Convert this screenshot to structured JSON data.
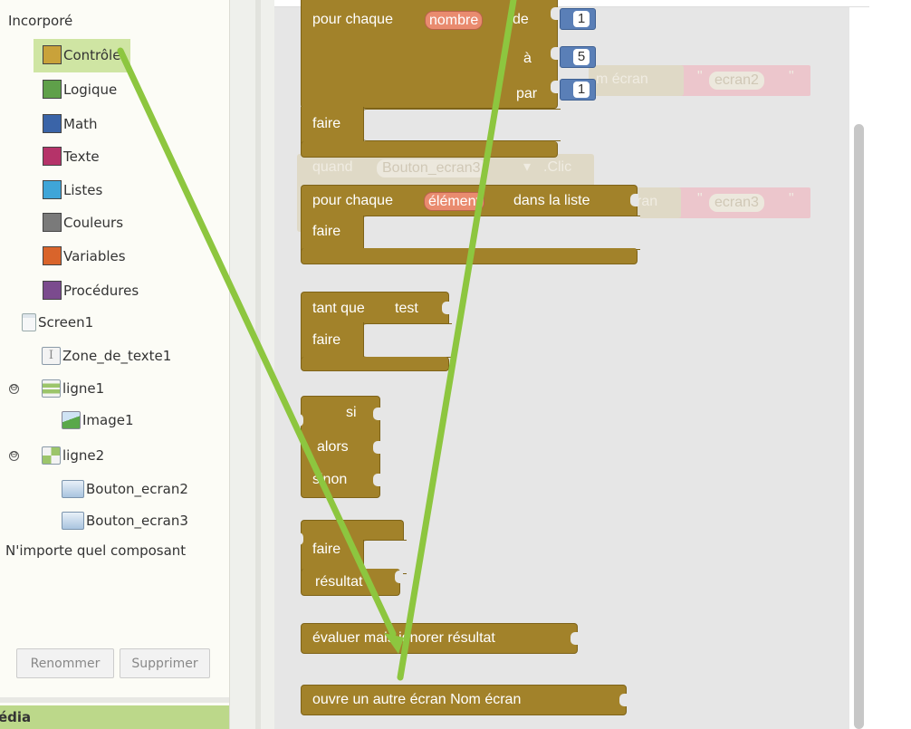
{
  "tree": {
    "header": "Incorporé",
    "builtins": [
      {
        "label": "Contrôle",
        "color": "#c9a23a",
        "icon": "control-swatch-icon",
        "selected": true
      },
      {
        "label": "Logique",
        "color": "#5fa04a",
        "icon": "logic-swatch-icon"
      },
      {
        "label": "Math",
        "color": "#3a64a8",
        "icon": "math-swatch-icon"
      },
      {
        "label": "Texte",
        "color": "#b53369",
        "icon": "text-swatch-icon"
      },
      {
        "label": "Listes",
        "color": "#3fa5d8",
        "icon": "lists-swatch-icon"
      },
      {
        "label": "Couleurs",
        "color": "#7a7a7a",
        "icon": "colors-swatch-icon"
      },
      {
        "label": "Variables",
        "color": "#d9642b",
        "icon": "variables-swatch-icon"
      },
      {
        "label": "Procédures",
        "color": "#7b4b8e",
        "icon": "procedures-swatch-icon"
      }
    ],
    "components": [
      {
        "label": "Screen1",
        "icon": "screen-icon"
      },
      {
        "label": "Zone_de_texte1",
        "icon": "textbox-icon"
      },
      {
        "label": "ligne1",
        "icon": "vertical-arrangement-icon",
        "toggle": "⊖"
      },
      {
        "label": "Image1",
        "icon": "image-icon"
      },
      {
        "label": "ligne2",
        "icon": "table-arrangement-icon",
        "toggle": "⊖"
      },
      {
        "label": "Bouton_ecran2",
        "icon": "button-icon"
      },
      {
        "label": "Bouton_ecran3",
        "icon": "button-icon"
      }
    ],
    "any_component": "N'importe quel composant",
    "rename_button": "Renommer",
    "delete_button": "Supprimer",
    "media_label": "édia"
  },
  "blocks": {
    "for_range": {
      "prefix": "pour chaque",
      "var": "nombre",
      "from_kw": "de",
      "to_kw": "à",
      "by_kw": "par",
      "do_kw": "faire",
      "from_val": "1",
      "to_val": "5",
      "by_val": "1"
    },
    "for_list": {
      "prefix": "pour chaque",
      "var": "élément",
      "suffix": "dans la liste",
      "do_kw": "faire"
    },
    "while": {
      "kw": "tant que",
      "test": "test",
      "do_kw": "faire"
    },
    "ifelse": {
      "if_kw": "si",
      "then_kw": "alors",
      "else_kw": "sinon"
    },
    "do_result": {
      "do_kw": "faire",
      "result_kw": "résultat"
    },
    "eval_ignore": {
      "text": "évaluer mais ignorer résultat"
    },
    "open_screen": {
      "text": "ouvre un autre écran  Nom écran"
    }
  },
  "ghost": {
    "when_kw": "quand",
    "button": "Bouton_ecran3",
    "event": ".Clic",
    "screen_name_1": "m écran",
    "screen_str_1": "ecran2",
    "screen_name_2": "ran",
    "screen_str_2": "ecran3",
    "quote": "\""
  },
  "colors": {
    "control": "#a2822a",
    "math_number": "#5a7fb7",
    "variable": "#e98b6f",
    "annotation_arrow": "#8dc63f"
  }
}
